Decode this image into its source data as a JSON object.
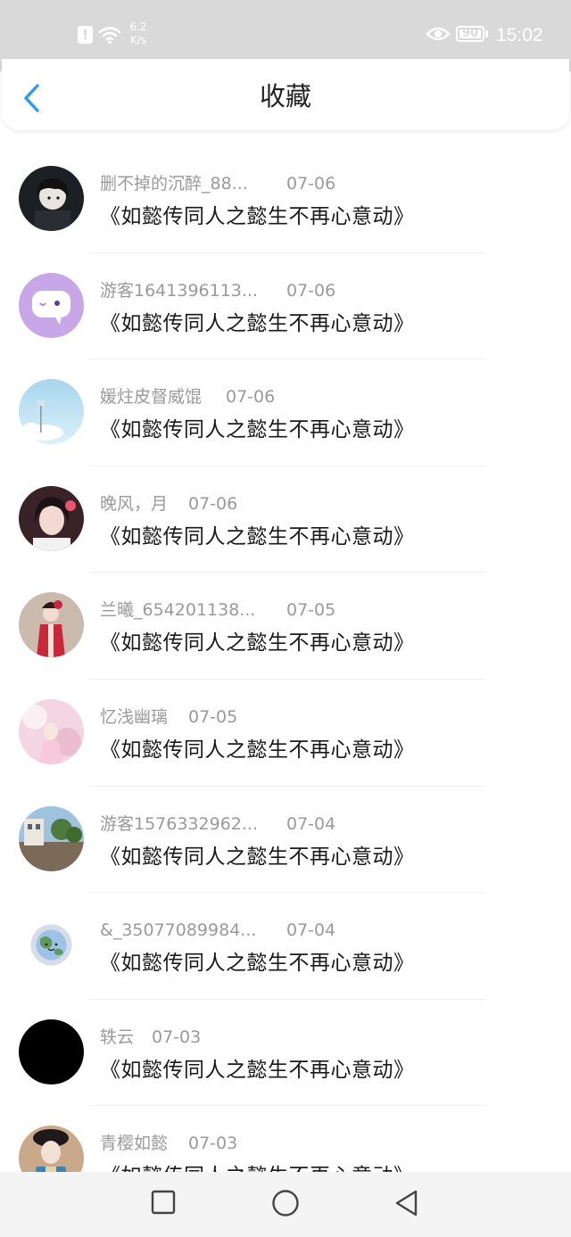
{
  "status_bar": {
    "speed_value": "6.2",
    "speed_unit": "K/s",
    "battery": "90",
    "time": "15:02",
    "icons": [
      "alert-icon",
      "wifi-icon",
      "eye-icon",
      "battery-icon"
    ]
  },
  "header": {
    "title": "收藏",
    "back_icon": "chevron-left-icon",
    "accent_color": "#2d9bf0"
  },
  "list": {
    "items": [
      {
        "name": "删不掉的沉醉_88...",
        "date": "07-06",
        "title": "《如懿传同人之懿生不再心意动》",
        "avatar": "anime-boy"
      },
      {
        "name": "游客1641396113...",
        "date": "07-06",
        "title": "《如懿传同人之懿生不再心意动》",
        "avatar": "purple-chat-bubble"
      },
      {
        "name": "媛炷皮督威馄",
        "date": "07-06",
        "title": "《如懿传同人之懿生不再心意动》",
        "avatar": "sky-photo"
      },
      {
        "name": "晚风，月",
        "date": "07-06",
        "title": "《如懿传同人之懿生不再心意动》",
        "avatar": "girl-photo"
      },
      {
        "name": "兰曦_654201138...",
        "date": "07-05",
        "title": "《如懿传同人之懿生不再心意动》",
        "avatar": "costume-photo"
      },
      {
        "name": "忆浅幽璃",
        "date": "07-05",
        "title": "《如懿传同人之懿生不再心意动》",
        "avatar": "pink-photo"
      },
      {
        "name": "游客1576332962...",
        "date": "07-04",
        "title": "《如懿传同人之懿生不再心意动》",
        "avatar": "street-photo"
      },
      {
        "name": "&_35077089984...",
        "date": "07-04",
        "title": "《如懿传同人之懿生不再心意动》",
        "avatar": "earth-sticker"
      },
      {
        "name": "轶云",
        "date": "07-03",
        "title": "《如懿传同人之懿生不再心意动》",
        "avatar": "black-circle"
      },
      {
        "name": "青樱如懿",
        "date": "07-03",
        "title": "《如懿传同人之懿生不再心意动》",
        "avatar": "palace-portrait"
      }
    ]
  },
  "nav_bar": {
    "recents_icon": "square-icon",
    "home_icon": "circle-icon",
    "back_icon": "triangle-back-icon"
  }
}
